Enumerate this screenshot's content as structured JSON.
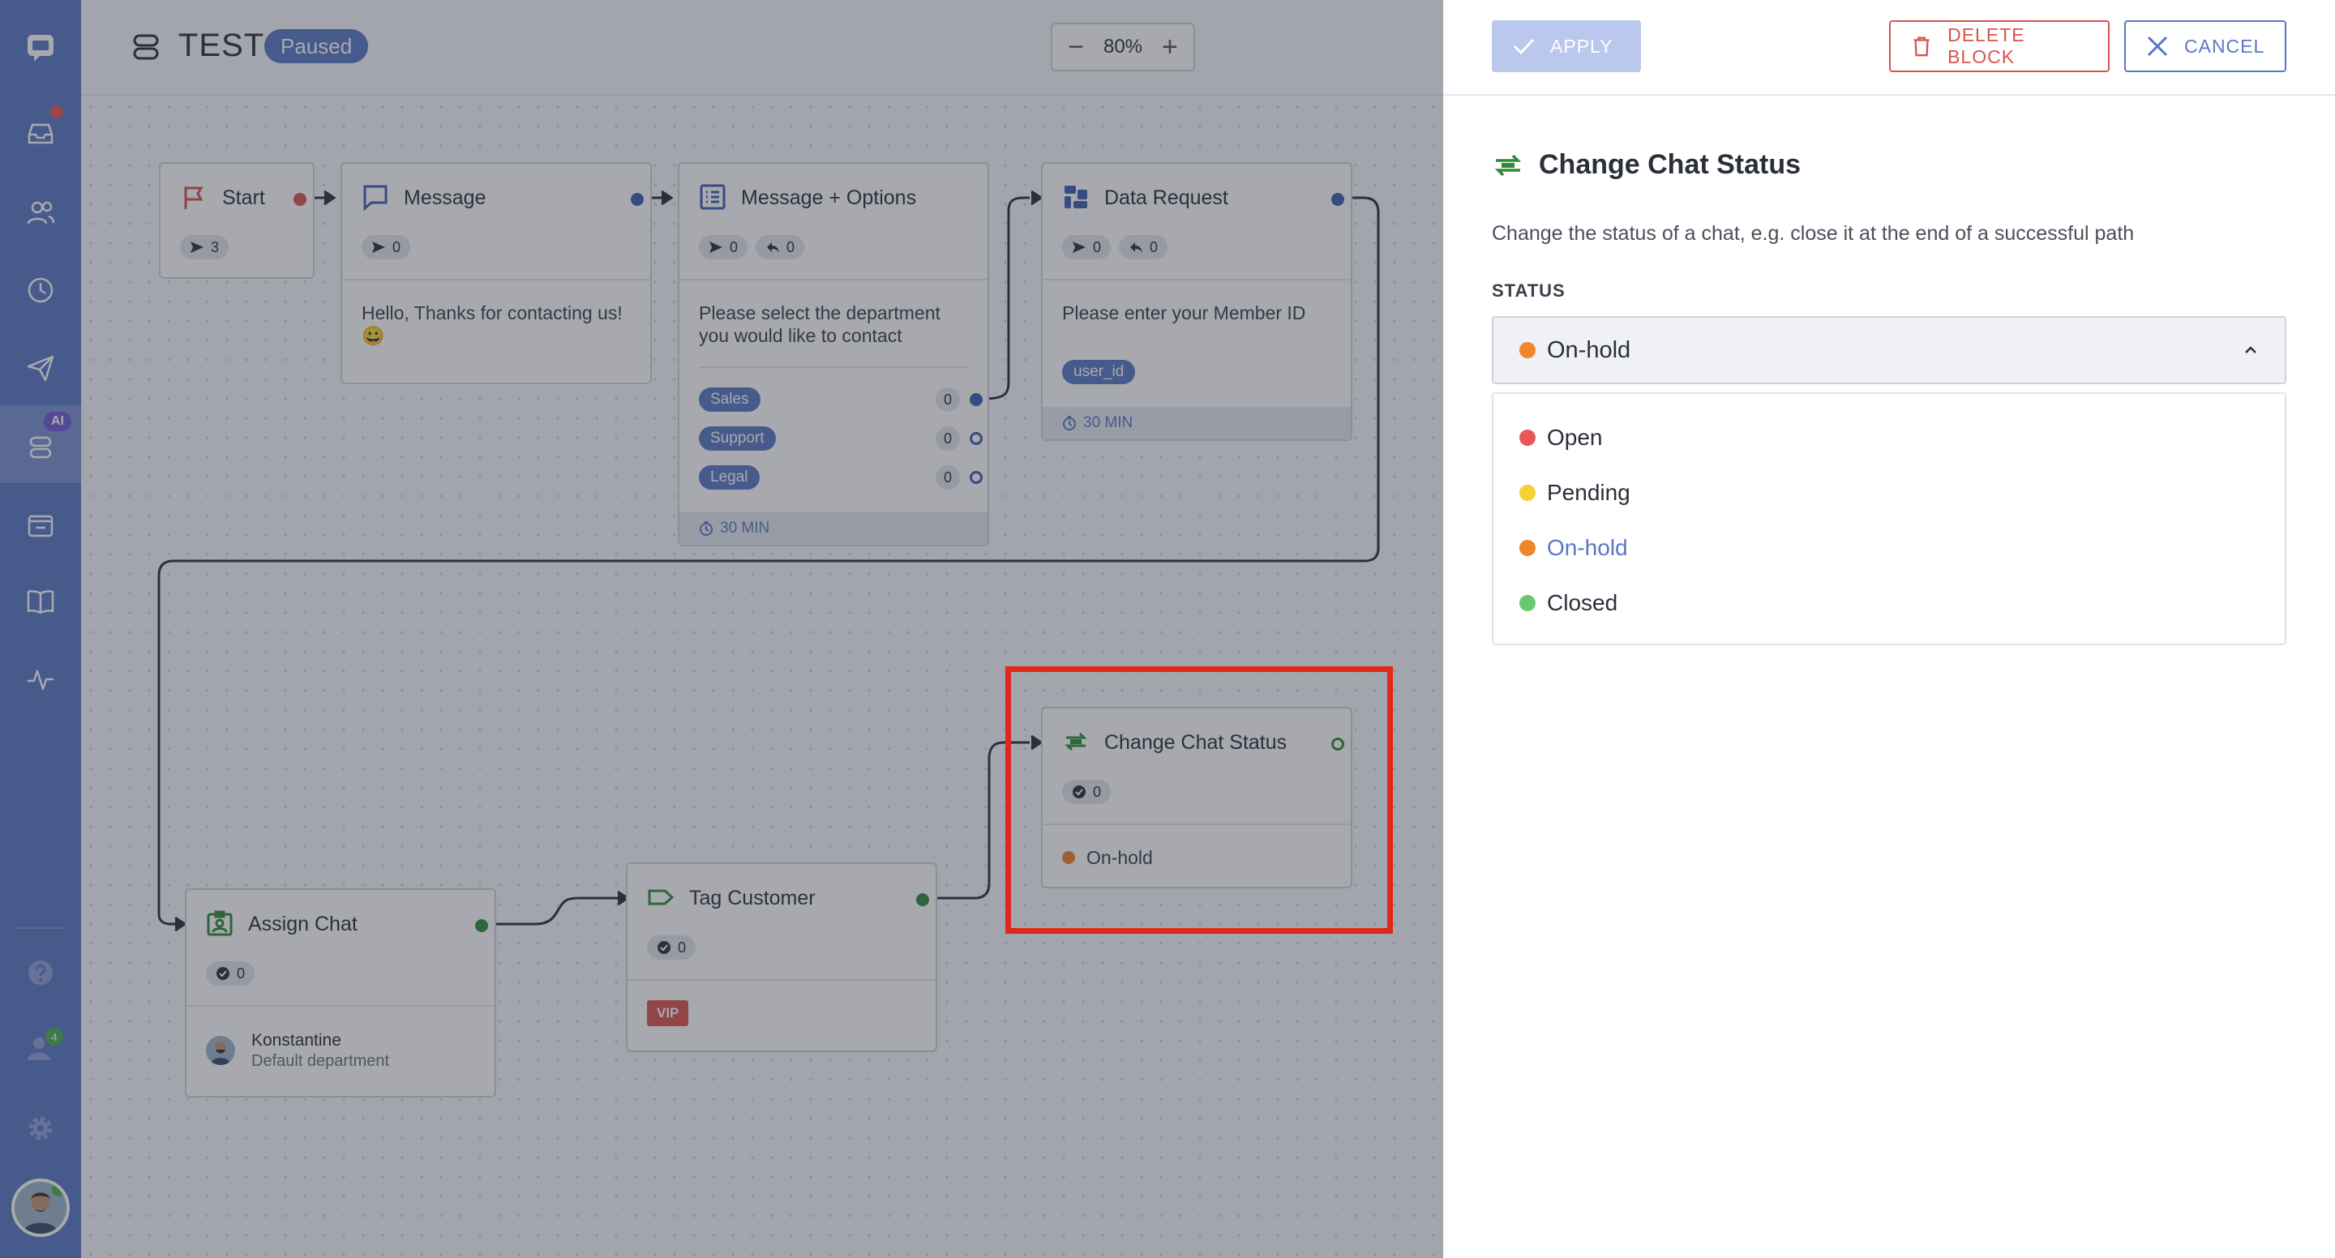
{
  "header": {
    "bot_name": "TEST",
    "status_badge": "Paused",
    "zoom": {
      "minus": "−",
      "value": "80%",
      "plus": "+"
    }
  },
  "rail": {
    "ai_badge": "AI",
    "agents_count": "4"
  },
  "nodes": {
    "start": {
      "title": "Start",
      "sent": "3"
    },
    "message": {
      "title": "Message",
      "sent": "0",
      "text": "Hello, Thanks for contacting us! 😀"
    },
    "options": {
      "title": "Message + Options",
      "sent": "0",
      "replies": "0",
      "text": "Please select the department you would like to contact",
      "options": [
        {
          "label": "Sales",
          "count": "0"
        },
        {
          "label": "Support",
          "count": "0"
        },
        {
          "label": "Legal",
          "count": "0"
        }
      ],
      "timeout": "30 MIN"
    },
    "data_request": {
      "title": "Data Request",
      "sent": "0",
      "replies": "0",
      "text": "Please enter your Member ID",
      "variable": "user_id",
      "timeout": "30 MIN"
    },
    "change_status": {
      "title": "Change Chat Status",
      "done": "0",
      "status": "On-hold"
    },
    "assign": {
      "title": "Assign Chat",
      "done": "0",
      "agent": "Konstantine",
      "department": "Default department"
    },
    "tag": {
      "title": "Tag Customer",
      "done": "0",
      "tag": "VIP"
    }
  },
  "panel": {
    "apply_label": "APPLY",
    "delete_label": "DELETE BLOCK",
    "cancel_label": "CANCEL",
    "title": "Change Chat Status",
    "description": "Change the status of a chat, e.g. close it at the end of a successful path",
    "status_label": "STATUS",
    "selected": "On-hold",
    "options": [
      {
        "label": "Open",
        "color": "#e8585a"
      },
      {
        "label": "Pending",
        "color": "#f5d033"
      },
      {
        "label": "On-hold",
        "color": "#f0862a"
      },
      {
        "label": "Closed",
        "color": "#6cc86f"
      }
    ]
  },
  "colors": {
    "brand": "#5a77c4",
    "danger": "#d9534f",
    "highlight": "#e0271c",
    "selected_option_text": "#5a77c4"
  },
  "icons": [
    "chat-logo-icon",
    "inbox-icon",
    "contacts-icon",
    "history-icon",
    "campaigns-icon",
    "chatbot-icon",
    "ticket-icon",
    "knowledge-base-icon",
    "analytics-icon",
    "help-icon",
    "agents-icon",
    "settings-icon",
    "flag-icon",
    "message-icon",
    "options-icon",
    "data-request-icon",
    "change-status-icon",
    "assign-icon",
    "tag-icon",
    "check-icon",
    "trash-icon",
    "close-icon",
    "chevron-up-icon"
  ]
}
